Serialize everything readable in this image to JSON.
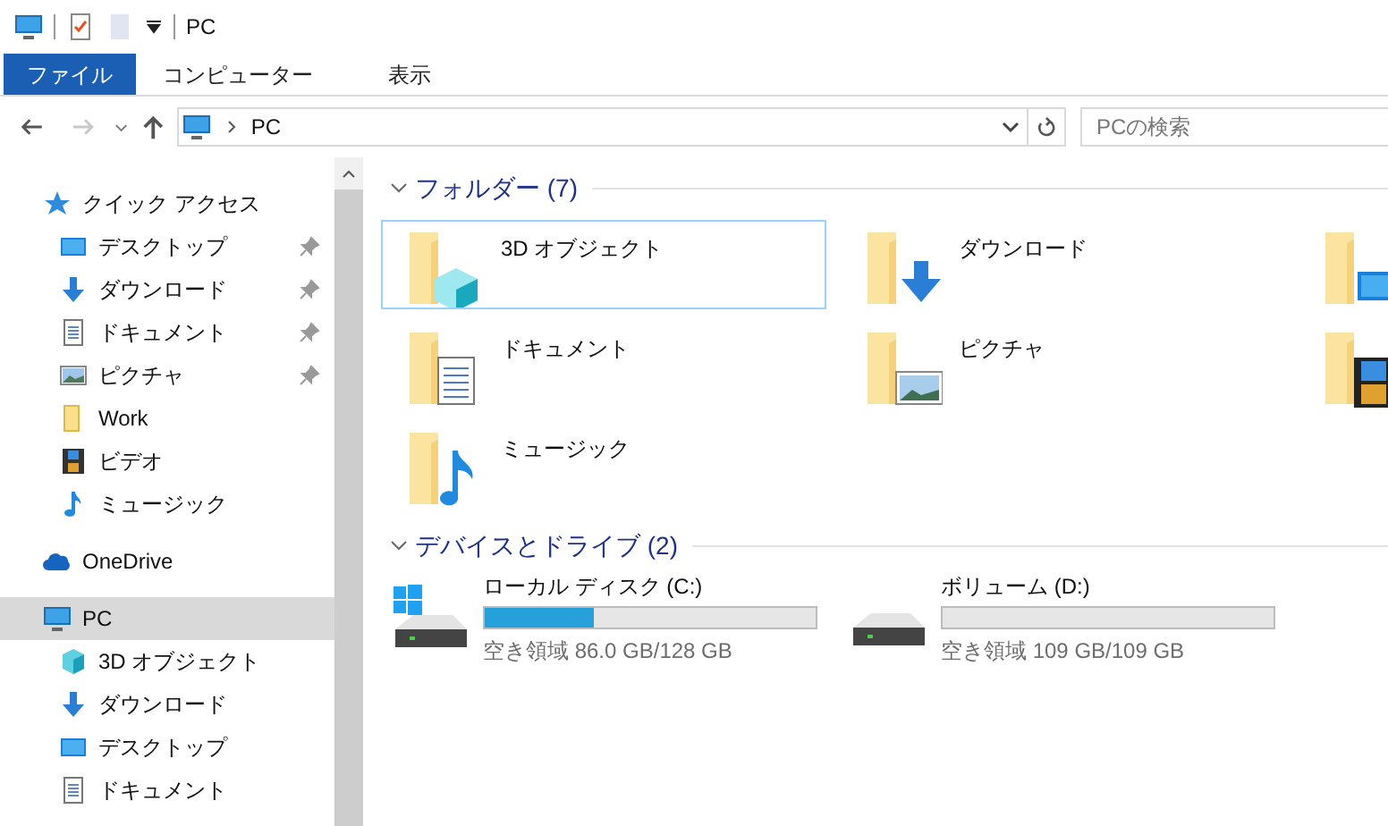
{
  "title_bar": {
    "title": "PC"
  },
  "ribbon_tabs": [
    {
      "label": "ファイル",
      "selected": true
    },
    {
      "label": "コンピューター",
      "selected": false
    },
    {
      "label": "表示",
      "selected": false
    }
  ],
  "navigation": {
    "forward_disabled": true,
    "address": "PC",
    "search": {
      "placeholder": "PCの検索"
    }
  },
  "sidebar": [
    {
      "label": "クイック アクセス",
      "kind": "star",
      "selected": false,
      "children": [
        {
          "label": "デスクトップ",
          "kind": "desktop",
          "pinned": true,
          "selected": false
        },
        {
          "label": "ダウンロード",
          "kind": "download",
          "pinned": true,
          "selected": false
        },
        {
          "label": "ドキュメント",
          "kind": "document",
          "pinned": true,
          "selected": false
        },
        {
          "label": "ピクチャ",
          "kind": "picture",
          "pinned": true,
          "selected": false
        },
        {
          "label": "Work",
          "kind": "folder",
          "pinned": false,
          "selected": false
        },
        {
          "label": "ビデオ",
          "kind": "video",
          "pinned": false,
          "selected": false
        },
        {
          "label": "ミュージック",
          "kind": "music",
          "pinned": false,
          "selected": false
        }
      ]
    },
    {
      "label": "OneDrive",
      "kind": "cloud",
      "selected": false
    },
    {
      "label": "PC",
      "kind": "pc",
      "selected": true,
      "children": [
        {
          "label": "3D オブジェクト",
          "kind": "cube",
          "selected": false
        },
        {
          "label": "ダウンロード",
          "kind": "download",
          "selected": false
        },
        {
          "label": "デスクトップ",
          "kind": "desktop",
          "selected": false
        },
        {
          "label": "ドキュメント",
          "kind": "document",
          "selected": false
        }
      ]
    }
  ],
  "folders": {
    "heading": "フォルダー (7)",
    "items": [
      {
        "label": "3D オブジェクト",
        "kind": "cube",
        "selected": true
      },
      {
        "label": "ダウンロード",
        "kind": "download",
        "selected": false
      },
      {
        "kind": "desktop",
        "selected": false
      },
      {
        "label": "ドキュメント",
        "kind": "document",
        "selected": false
      },
      {
        "label": "ピクチャ",
        "kind": "picture",
        "selected": false
      },
      {
        "kind": "video",
        "selected": false
      },
      {
        "label": "ミュージック",
        "kind": "music",
        "selected": false
      }
    ]
  },
  "drives": {
    "heading": "デバイスとドライブ (2)",
    "items": [
      {
        "label": "ローカル ディスク (C:)",
        "kind": "system",
        "level": 0.33,
        "free": "空き領域 86.0 GB/128 GB"
      },
      {
        "label": "ボリューム (D:)",
        "kind": "disk",
        "level": 0,
        "free": "空き領域 109 GB/109 GB"
      }
    ]
  }
}
